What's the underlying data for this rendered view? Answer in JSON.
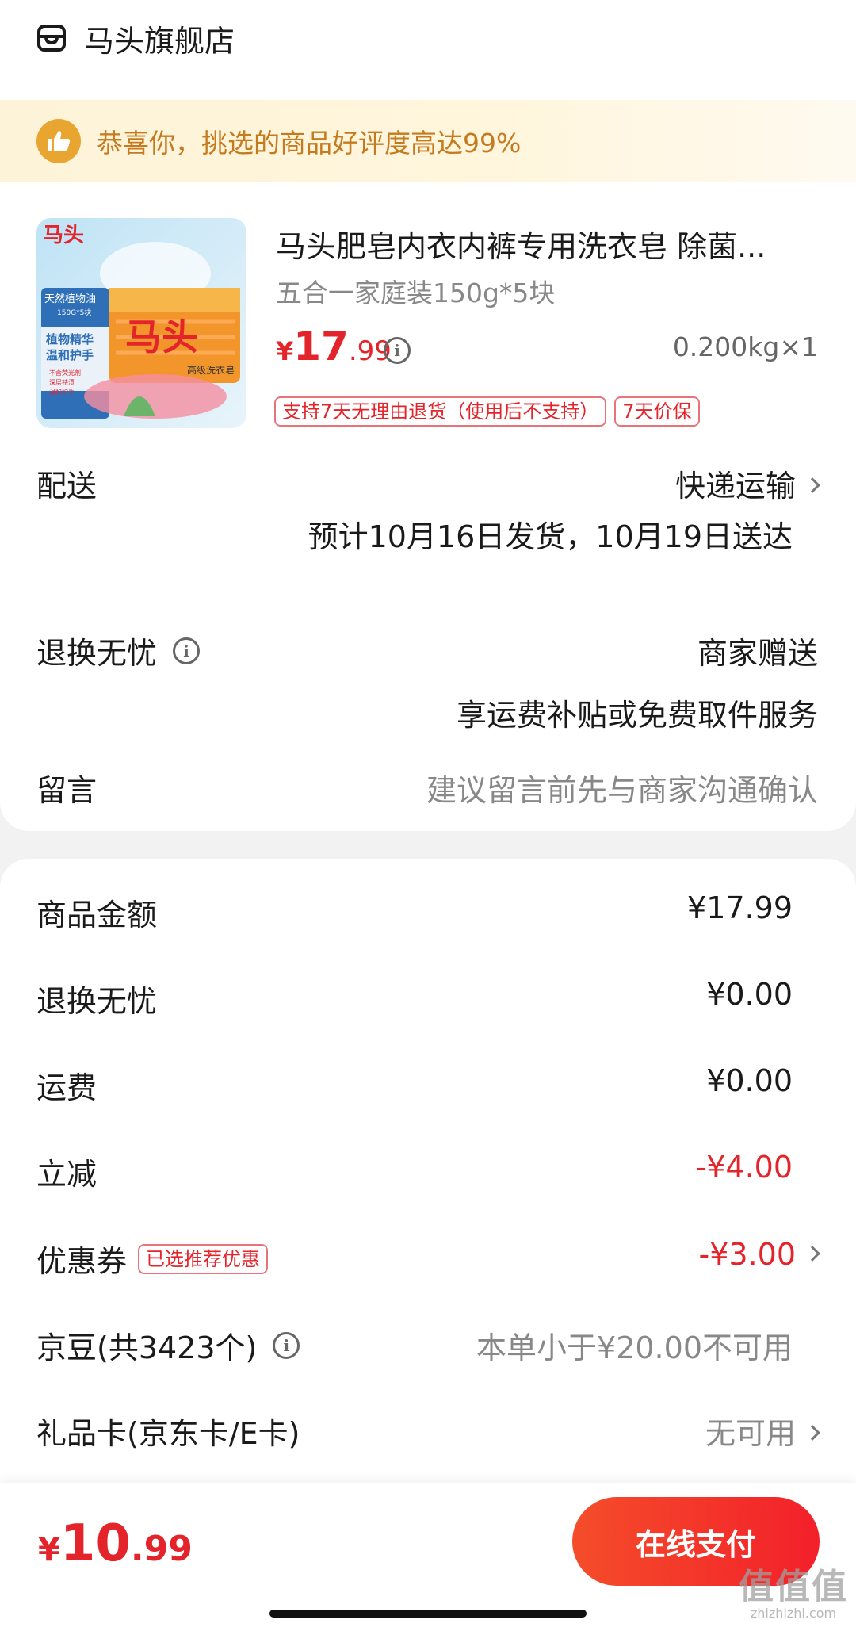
{
  "store": {
    "icon": "store-icon",
    "name": "马头旗舰店"
  },
  "praise": {
    "icon": "thumbs-up-icon",
    "text": "恭喜你，挑选的商品好评度高达99%"
  },
  "product": {
    "title": "马头肥皂内衣内裤专用洗衣皂 除菌...",
    "spec": "五合一家庭装150g*5块",
    "price_symbol": "¥",
    "price_int": "17",
    "price_dec": ".99",
    "weight": "0.200kg×1",
    "tags": [
      "支持7天无理由退货（使用后不支持）",
      "7天价保"
    ],
    "image_text": {
      "brand": "马头",
      "line1": "天然植物油",
      "line2": "150G*5块",
      "line3": "植物精华",
      "line4": "温和护手",
      "line5": "不含荧光剂",
      "line6": "深层祛渍",
      "line7": "温和护手",
      "line8": "高级洗衣皂"
    }
  },
  "delivery": {
    "label": "配送",
    "method": "快递运输",
    "estimate": "预计10月16日发货，10月19日送达"
  },
  "worry_free": {
    "label": "退换无忧",
    "value": "商家赠送",
    "desc": "享运费补贴或免费取件服务"
  },
  "message": {
    "label": "留言",
    "placeholder": "建议留言前先与商家沟通确认"
  },
  "fees": {
    "goods_label": "商品金额",
    "goods_value": "¥17.99",
    "worry_label": "退换无忧",
    "worry_value": "¥0.00",
    "shipping_label": "运费",
    "shipping_value": "¥0.00",
    "discount_label": "立减",
    "discount_value": "-¥4.00",
    "coupon_label": "优惠券",
    "coupon_badge": "已选推荐优惠",
    "coupon_value": "-¥3.00",
    "jingdou_label": "京豆(共3423个)",
    "jingdou_value": "本单小于¥20.00不可用",
    "giftcard_label": "礼品卡(京东卡/E卡)",
    "giftcard_value": "无可用"
  },
  "footer": {
    "total_symbol": "¥",
    "total_int": "10",
    "total_dec": ".99",
    "pay_button": "在线支付"
  },
  "watermark": {
    "big": "值值值",
    "small": "zhizhizhi.com"
  },
  "colors": {
    "accent_red": "#e3242b",
    "praise_orange": "#c67a1e",
    "pay_gradient": "#f44d2a"
  }
}
